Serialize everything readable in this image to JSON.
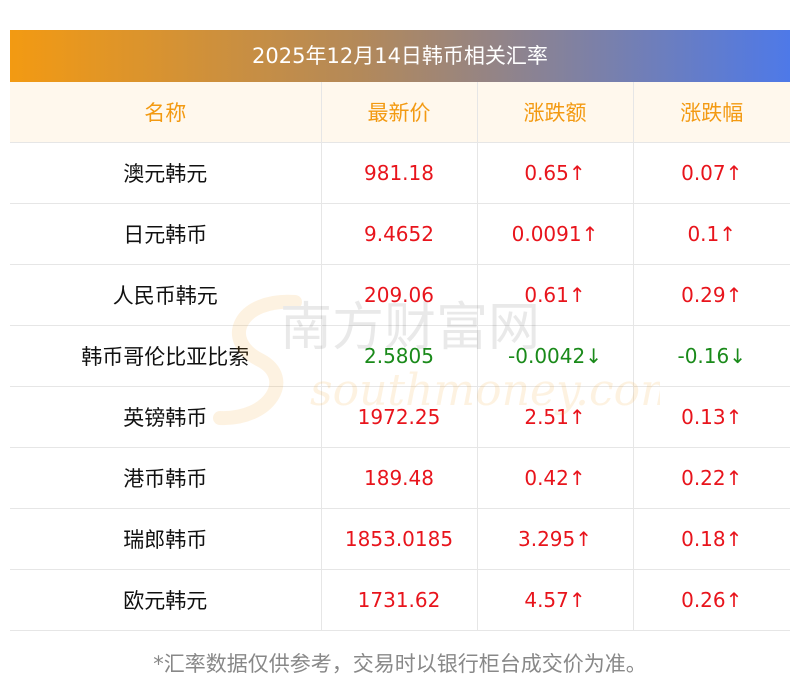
{
  "title": "2025年12月14日韩币相关汇率",
  "headers": [
    "名称",
    "最新价",
    "涨跌额",
    "涨跌幅"
  ],
  "rows": [
    {
      "name": "澳元韩元",
      "price": "981.18",
      "change": "0.65↑",
      "pct": "0.07↑",
      "dir": "up"
    },
    {
      "name": "日元韩币",
      "price": "9.4652",
      "change": "0.0091↑",
      "pct": "0.1↑",
      "dir": "up"
    },
    {
      "name": "人民币韩元",
      "price": "209.06",
      "change": "0.61↑",
      "pct": "0.29↑",
      "dir": "up"
    },
    {
      "name": "韩币哥伦比亚比索",
      "price": "2.5805",
      "change": "-0.0042↓",
      "pct": "-0.16↓",
      "dir": "down"
    },
    {
      "name": "英镑韩币",
      "price": "1972.25",
      "change": "2.51↑",
      "pct": "0.13↑",
      "dir": "up"
    },
    {
      "name": "港币韩币",
      "price": "189.48",
      "change": "0.42↑",
      "pct": "0.22↑",
      "dir": "up"
    },
    {
      "name": "瑞郎韩币",
      "price": "1853.0185",
      "change": "3.295↑",
      "pct": "0.18↑",
      "dir": "up"
    },
    {
      "name": "欧元韩元",
      "price": "1731.62",
      "change": "4.57↑",
      "pct": "0.26↑",
      "dir": "up"
    }
  ],
  "watermark": {
    "text_cn": "南方财富网",
    "text_en": "southmoney.com",
    "color": "#f39a12"
  },
  "footnote": "*汇率数据仅供参考，交易时以银行柜台成交价为准。",
  "colors": {
    "up": "#e8141c",
    "down": "#1a8a1a",
    "header_text": "#f39a12",
    "header_bg": "#fff8ed"
  }
}
